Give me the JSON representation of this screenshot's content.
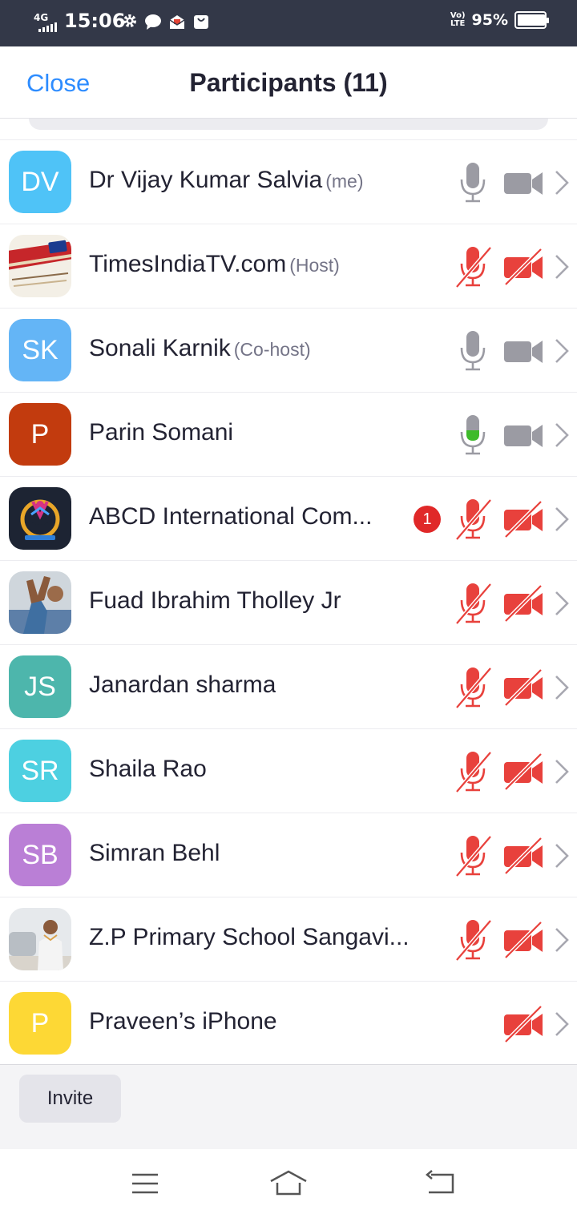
{
  "status_bar": {
    "network": "4G",
    "time": "15:06",
    "volte_top": "Vo)",
    "volte_bottom": "LTE",
    "battery_text": "95%",
    "battery_level": 0.95,
    "icons": [
      "gear-icon",
      "chat-bubble-icon",
      "mail-icon",
      "shopping-bag-icon"
    ]
  },
  "header": {
    "close_label": "Close",
    "title": "Participants (11)"
  },
  "colors": {
    "accent": "#2d8cff",
    "muted_red": "#e8413c",
    "active_mic_green": "#3dbb2a",
    "icon_gray": "#9b9ba3"
  },
  "participants": [
    {
      "name": "Dr Vijay Kumar Salvia",
      "tag": "(me)",
      "initials": "DV",
      "avatar_color": "#4fc3f7",
      "mic": "on",
      "video": "on"
    },
    {
      "name": "TimesIndiaTV.com",
      "tag": "(Host)",
      "initials": "",
      "avatar_image": "timesindia-logo",
      "mic": "muted",
      "video": "off"
    },
    {
      "name": "Sonali Karnik",
      "tag": "(Co-host)",
      "initials": "SK",
      "avatar_color": "#64b5f6",
      "mic": "on",
      "video": "on"
    },
    {
      "name": "Parin Somani",
      "tag": "",
      "initials": "P",
      "avatar_color": "#c23b0e",
      "mic": "speaking",
      "video": "on"
    },
    {
      "name": "ABCD International Com...",
      "tag": "",
      "initials": "",
      "avatar_image": "abcd-logo",
      "badge": "1",
      "mic": "muted",
      "video": "off"
    },
    {
      "name": "Fuad Ibrahim Tholley Jr",
      "tag": "",
      "initials": "",
      "avatar_image": "photo-hand",
      "mic": "muted",
      "video": "off"
    },
    {
      "name": "Janardan sharma",
      "tag": "",
      "initials": "JS",
      "avatar_color": "#4db6ac",
      "mic": "muted",
      "video": "off"
    },
    {
      "name": "Shaila Rao",
      "tag": "",
      "initials": "SR",
      "avatar_color": "#4dd0e1",
      "mic": "muted",
      "video": "off"
    },
    {
      "name": "Simran Behl",
      "tag": "",
      "initials": "SB",
      "avatar_color": "#ba7fd6",
      "mic": "muted",
      "video": "off"
    },
    {
      "name": "Z.P Primary School Sangavi...",
      "tag": "",
      "initials": "",
      "avatar_image": "photo-man",
      "mic": "muted",
      "video": "off"
    },
    {
      "name": "Praveen’s iPhone",
      "tag": "",
      "initials": "P",
      "avatar_color": "#fdd835",
      "mic": "none",
      "video": "off"
    }
  ],
  "footer": {
    "invite_label": "Invite"
  },
  "nav": [
    "menu-icon",
    "home-icon",
    "back-icon"
  ]
}
